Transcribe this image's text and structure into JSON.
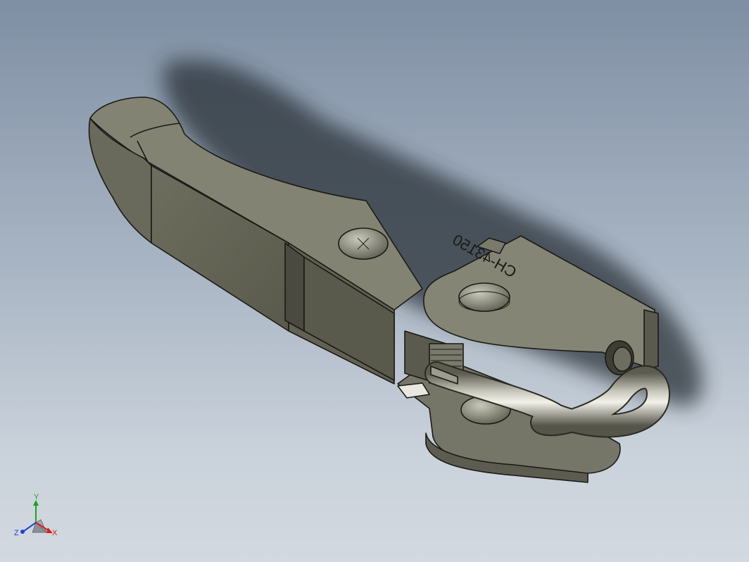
{
  "part": {
    "engraved_label": "CH-43150"
  },
  "triad": {
    "x_label": "X",
    "y_label": "Y",
    "z_label": "Z",
    "colors": {
      "x": "#d42020",
      "y": "#20a020",
      "z": "#2040d0"
    }
  },
  "colors": {
    "background_top": "#7f8fa3",
    "background_bottom": "#d3d9e0",
    "metal_light": "#8a8a7a",
    "metal_dark": "#5a5a4e",
    "edge": "#1a1a16"
  }
}
